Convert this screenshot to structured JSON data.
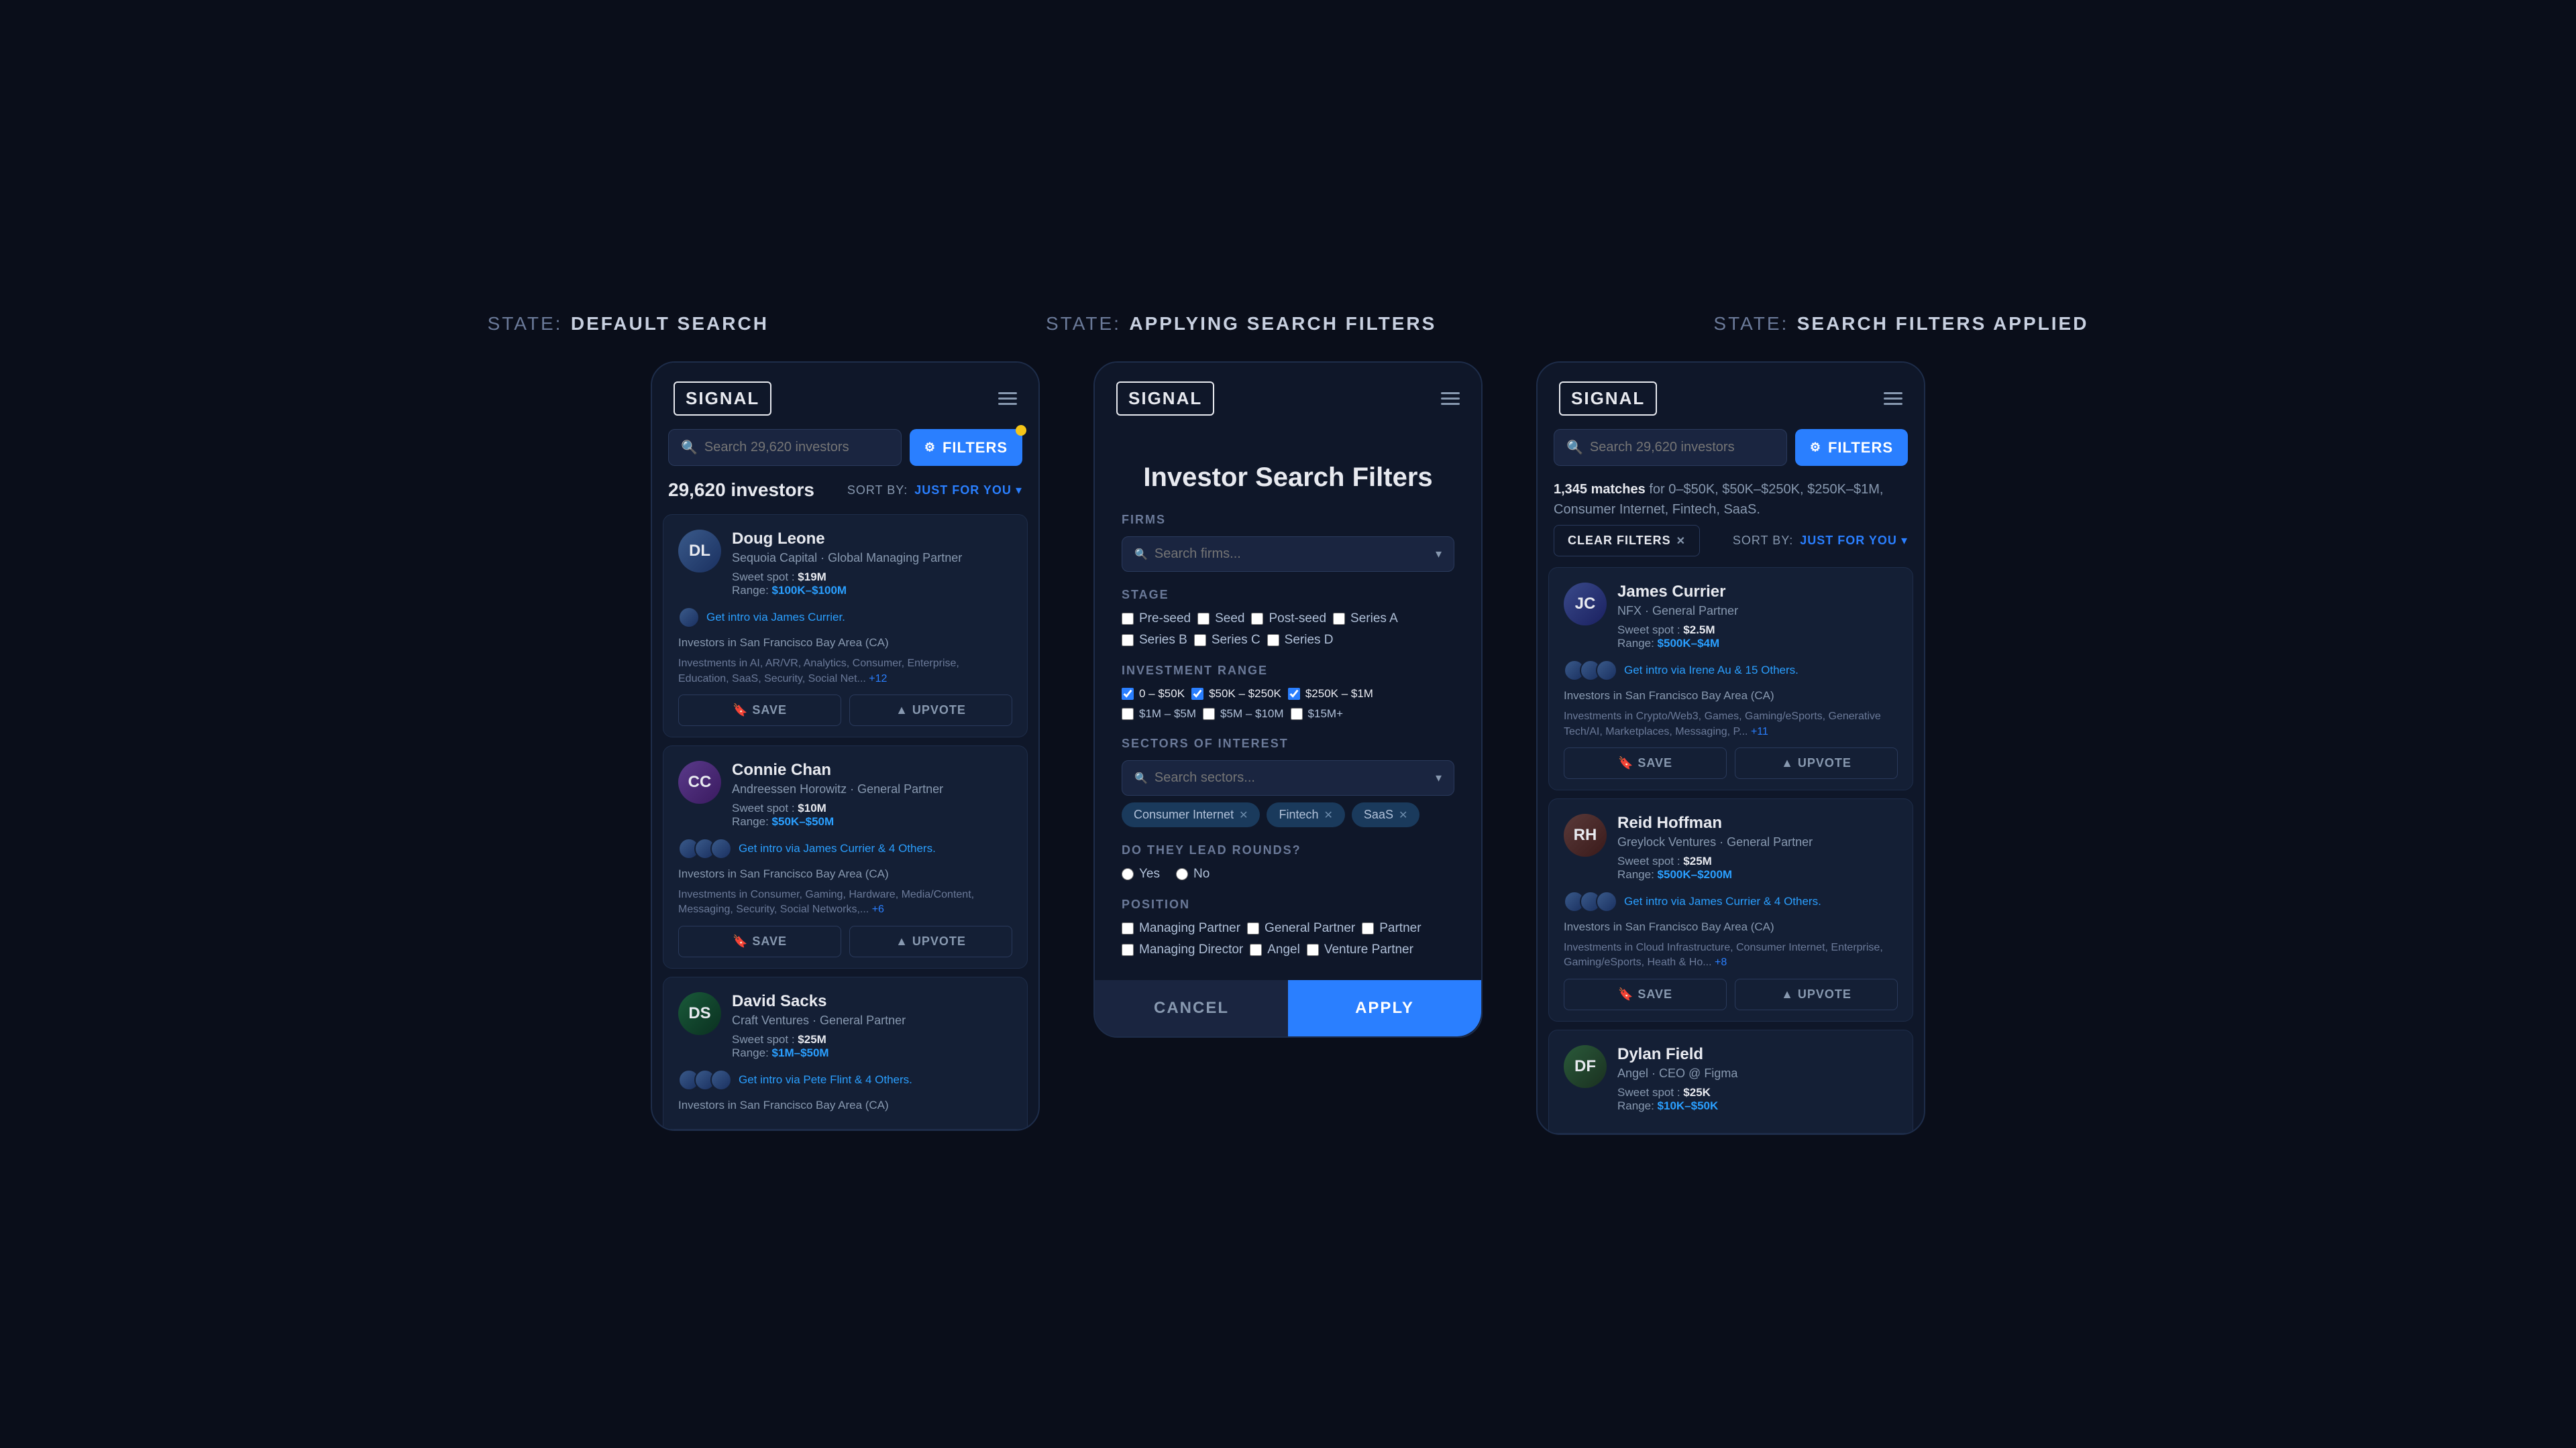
{
  "states": [
    {
      "label": "STATE:",
      "value": "DEFAULT SEARCH"
    },
    {
      "label": "STATE:",
      "value": "APPLYING SEARCH FILTERS"
    },
    {
      "label": "STATE:",
      "value": "SEARCH FILTERS APPLIED"
    }
  ],
  "screen1": {
    "logo": "SIGNAL",
    "search_placeholder": "Search 29,620 investors",
    "filters_label": "FILTERS",
    "investors_count": "29,620 investors",
    "sort_prefix": "SORT BY:",
    "sort_value": "JUST FOR YOU",
    "investors": [
      {
        "name": "Doug Leone",
        "firm": "Sequoia Capital · Global Managing Partner",
        "sweet_spot": "$19M",
        "range": "$100K–$100M",
        "intro": "Get intro via James Currier.",
        "location": "Investors in San Francisco Bay Area (CA)",
        "investments": "Investments in AI, AR/VR, Analytics, Consumer, Enterprise, Education, SaaS, Security, Social Net...",
        "extra": "+12"
      },
      {
        "name": "Connie Chan",
        "firm": "Andreessen Horowitz · General Partner",
        "sweet_spot": "$10M",
        "range": "$50K–$50M",
        "intro": "Get intro via James Currier & 4 Others.",
        "location": "Investors in San Francisco Bay Area (CA)",
        "investments": "Investments in Consumer, Gaming, Hardware, Media/Content, Messaging, Security, Social Networks,...",
        "extra": "+6"
      },
      {
        "name": "David Sacks",
        "firm": "Craft Ventures · General Partner",
        "sweet_spot": "$25M",
        "range": "$1M–$50M",
        "intro": "Get intro via Pete Flint & 4 Others.",
        "location": "Investors in San Francisco Bay Area (CA)",
        "investments": "",
        "extra": ""
      }
    ]
  },
  "screen2": {
    "logo": "SIGNAL",
    "title": "Investor Search Filters",
    "firms_label": "FIRMS",
    "firms_placeholder": "Search firms...",
    "stage_label": "STAGE",
    "stages": [
      "Pre-seed",
      "Seed",
      "Post-seed",
      "Series A",
      "Series B",
      "Series C",
      "Series D"
    ],
    "investment_range_label": "INVESTMENT RANGE",
    "ranges": [
      {
        "label": "0 – $50K",
        "checked": true
      },
      {
        "label": "$50K – $250K",
        "checked": true
      },
      {
        "label": "$250K – $1M",
        "checked": true
      },
      {
        "label": "$1M – $5M",
        "checked": false
      },
      {
        "label": "$5M – $10M",
        "checked": false
      },
      {
        "label": "$15M+",
        "checked": false
      }
    ],
    "sectors_label": "SECTORS OF INTEREST",
    "sectors_placeholder": "Search sectors...",
    "active_sectors": [
      "Consumer Internet",
      "Fintech",
      "SaaS"
    ],
    "leads_label": "DO THEY LEAD ROUNDS?",
    "leads_options": [
      "Yes",
      "No"
    ],
    "position_label": "POSITION",
    "positions": [
      "Managing Partner",
      "General Partner",
      "Partner",
      "Managing Director",
      "Angel",
      "Venture Partner"
    ],
    "cancel_label": "CANCEL",
    "apply_label": "APPLY"
  },
  "screen3": {
    "logo": "SIGNAL",
    "search_placeholder": "Search 29,620 investors",
    "filters_label": "FILTERS",
    "clear_filters_label": "CLEAR FILTERS",
    "sort_prefix": "SORT BY:",
    "sort_value": "JUST FOR YOU",
    "matches_text": "1,345 matches",
    "matches_for": "for 0–$50K, $50K–$250K, $250K–$1M, Consumer Internet, Fintech, SaaS.",
    "investors": [
      {
        "name": "James Currier",
        "firm": "NFX · General Partner",
        "sweet_spot": "$2.5M",
        "range": "$500K–$4M",
        "intro": "Get intro via Irene Au & 15 Others.",
        "location": "Investors in San Francisco Bay Area (CA)",
        "investments": "Investments in Crypto/Web3, Games, Gaming/eSports, Generative Tech/AI, Marketplaces, Messaging, P...",
        "extra": "+11"
      },
      {
        "name": "Reid Hoffman",
        "firm": "Greylock Ventures · General Partner",
        "sweet_spot": "$25M",
        "range": "$500K–$200M",
        "intro": "Get intro via James Currier & 4 Others.",
        "location": "Investors in San Francisco Bay Area (CA)",
        "investments": "Investments in Cloud Infrastructure, Consumer Internet, Enterprise, Gaming/eSports, Heath & Ho...",
        "extra": "+8"
      },
      {
        "name": "Dylan Field",
        "firm": "Angel · CEO @ Figma",
        "sweet_spot": "$25K",
        "range": "$10K–$50K",
        "intro": "",
        "location": "",
        "investments": "",
        "extra": ""
      }
    ]
  },
  "icons": {
    "search": "🔍",
    "filter": "⚙",
    "save": "🔖",
    "upvote": "▲",
    "chevron_down": "▾",
    "close": "✕",
    "hamburger": "≡"
  }
}
